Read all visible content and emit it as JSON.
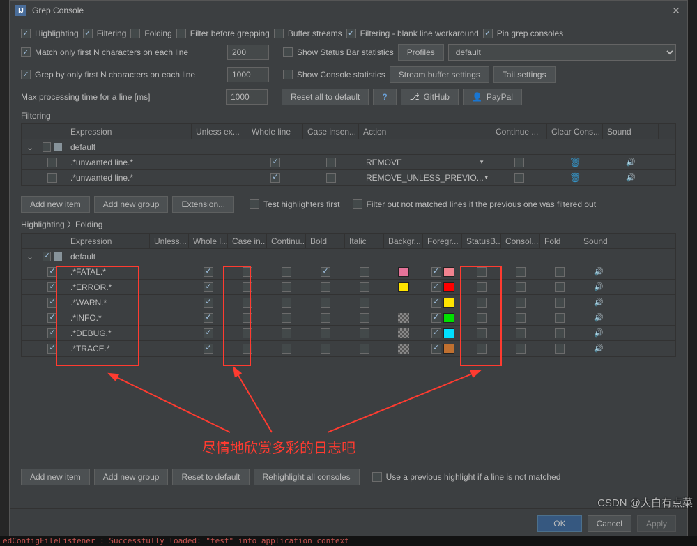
{
  "window": {
    "title": "Grep Console"
  },
  "top_checks": {
    "highlighting": "Highlighting",
    "filtering": "Filtering",
    "folding": "Folding",
    "filter_before": "Filter before grepping",
    "buffer_streams": "Buffer streams",
    "blank_line": "Filtering - blank line workaround",
    "pin": "Pin grep consoles"
  },
  "row2": {
    "match_first": "Match only first N characters on each line",
    "match_n": "200",
    "show_status": "Show Status Bar statistics",
    "profiles_btn": "Profiles",
    "profile_value": "default"
  },
  "row3": {
    "grep_first": "Grep by only first N characters on each line",
    "grep_n": "1000",
    "show_console": "Show Console statistics",
    "stream_btn": "Stream buffer settings",
    "tail_btn": "Tail settings"
  },
  "row4": {
    "max_time": "Max processing time for a line [ms]",
    "max_val": "1000",
    "reset_btn": "Reset all to default",
    "github_btn": "GitHub",
    "paypal_btn": "PayPal"
  },
  "filtering_section": {
    "title": "Filtering",
    "cols": [
      "",
      "",
      "Expression",
      "Unless ex...",
      "Whole line",
      "Case insen...",
      "Action",
      "Continue ...",
      "Clear Cons...",
      "Sound"
    ],
    "group": "default",
    "rows": [
      {
        "expr": ".*unwanted line.*",
        "whole": true,
        "action": "REMOVE"
      },
      {
        "expr": ".*unwanted line.*",
        "whole": true,
        "action": "REMOVE_UNLESS_PREVIO..."
      }
    ],
    "btns": {
      "add_item": "Add new item",
      "add_group": "Add new group",
      "ext": "Extension...",
      "test": "Test highlighters first",
      "filter_out": "Filter out not matched lines if the previous one was filtered out"
    }
  },
  "highlight_section": {
    "title": "Highlighting 〉Folding",
    "cols": [
      "",
      "",
      "Expression",
      "Unless...",
      "Whole l...",
      "Case in...",
      "Continu...",
      "Bold",
      "Italic",
      "Backgr...",
      "Foregr...",
      "StatusB...",
      "Consol...",
      "Fold",
      "Sound"
    ],
    "group": "default",
    "rows": [
      {
        "expr": ".*FATAL.*",
        "bold": true,
        "bg": "#e57399",
        "fg": "#f2838f"
      },
      {
        "expr": ".*ERROR.*",
        "bg": "#ffe400",
        "fg": "#ff0000"
      },
      {
        "expr": ".*WARN.*",
        "bg": "",
        "fg": "#ffe400"
      },
      {
        "expr": ".*INFO.*",
        "bg": "checker",
        "fg": "#00e000"
      },
      {
        "expr": ".*DEBUG.*",
        "bg": "checker",
        "fg": "#00e0ff"
      },
      {
        "expr": ".*TRACE.*",
        "bg": "checker",
        "fg": "#c07030"
      }
    ],
    "btns": {
      "add_item": "Add new item",
      "add_group": "Add new group",
      "reset": "Reset to default",
      "rehi": "Rehighlight all consoles",
      "use_prev": "Use a previous highlight if a line is not matched"
    }
  },
  "annotation": "尽情地欣赏多彩的日志吧",
  "footer": {
    "ok": "OK",
    "cancel": "Cancel",
    "apply": "Apply"
  },
  "watermark": "CSDN @大白有点菜",
  "bottom_log": "edConfigFileListener  : Successfully loaded: \"test\" into application context"
}
